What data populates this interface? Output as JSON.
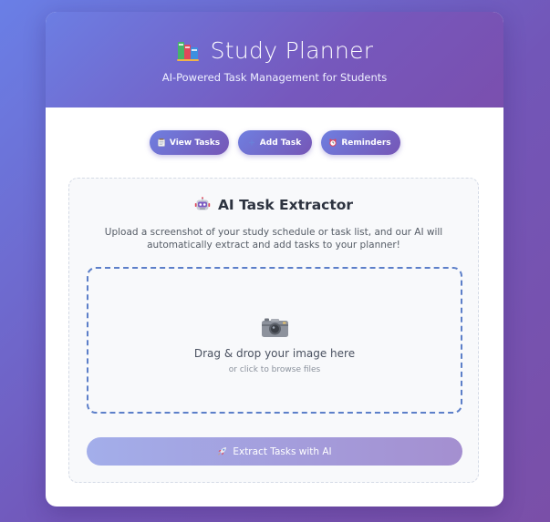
{
  "header": {
    "title": "Study Planner",
    "subtitle": "AI-Powered Task Management for Students",
    "icon": "books-icon"
  },
  "nav": {
    "view_tasks": {
      "label": "View Tasks",
      "icon": "notepad-icon"
    },
    "add_task": {
      "label": "Add Task",
      "icon": "plus-icon"
    },
    "reminders": {
      "label": "Reminders",
      "icon": "alarm-clock-icon"
    }
  },
  "extractor": {
    "title": "AI Task Extractor",
    "icon": "robot-icon",
    "description": "Upload a screenshot of your study schedule or task list, and our AI will automatically extract and add tasks to your planner!",
    "dropzone": {
      "icon": "camera-icon",
      "main_text": "Drag & drop your image here",
      "sub_text": "or click to browse files"
    },
    "extract_button": {
      "label": "Extract Tasks with AI",
      "icon": "rocket-icon"
    }
  },
  "colors": {
    "accent": "#7463c9",
    "dropzone_border": "#5c7fc9",
    "background_start": "#6a7fe6",
    "background_end": "#7a4fa8"
  }
}
